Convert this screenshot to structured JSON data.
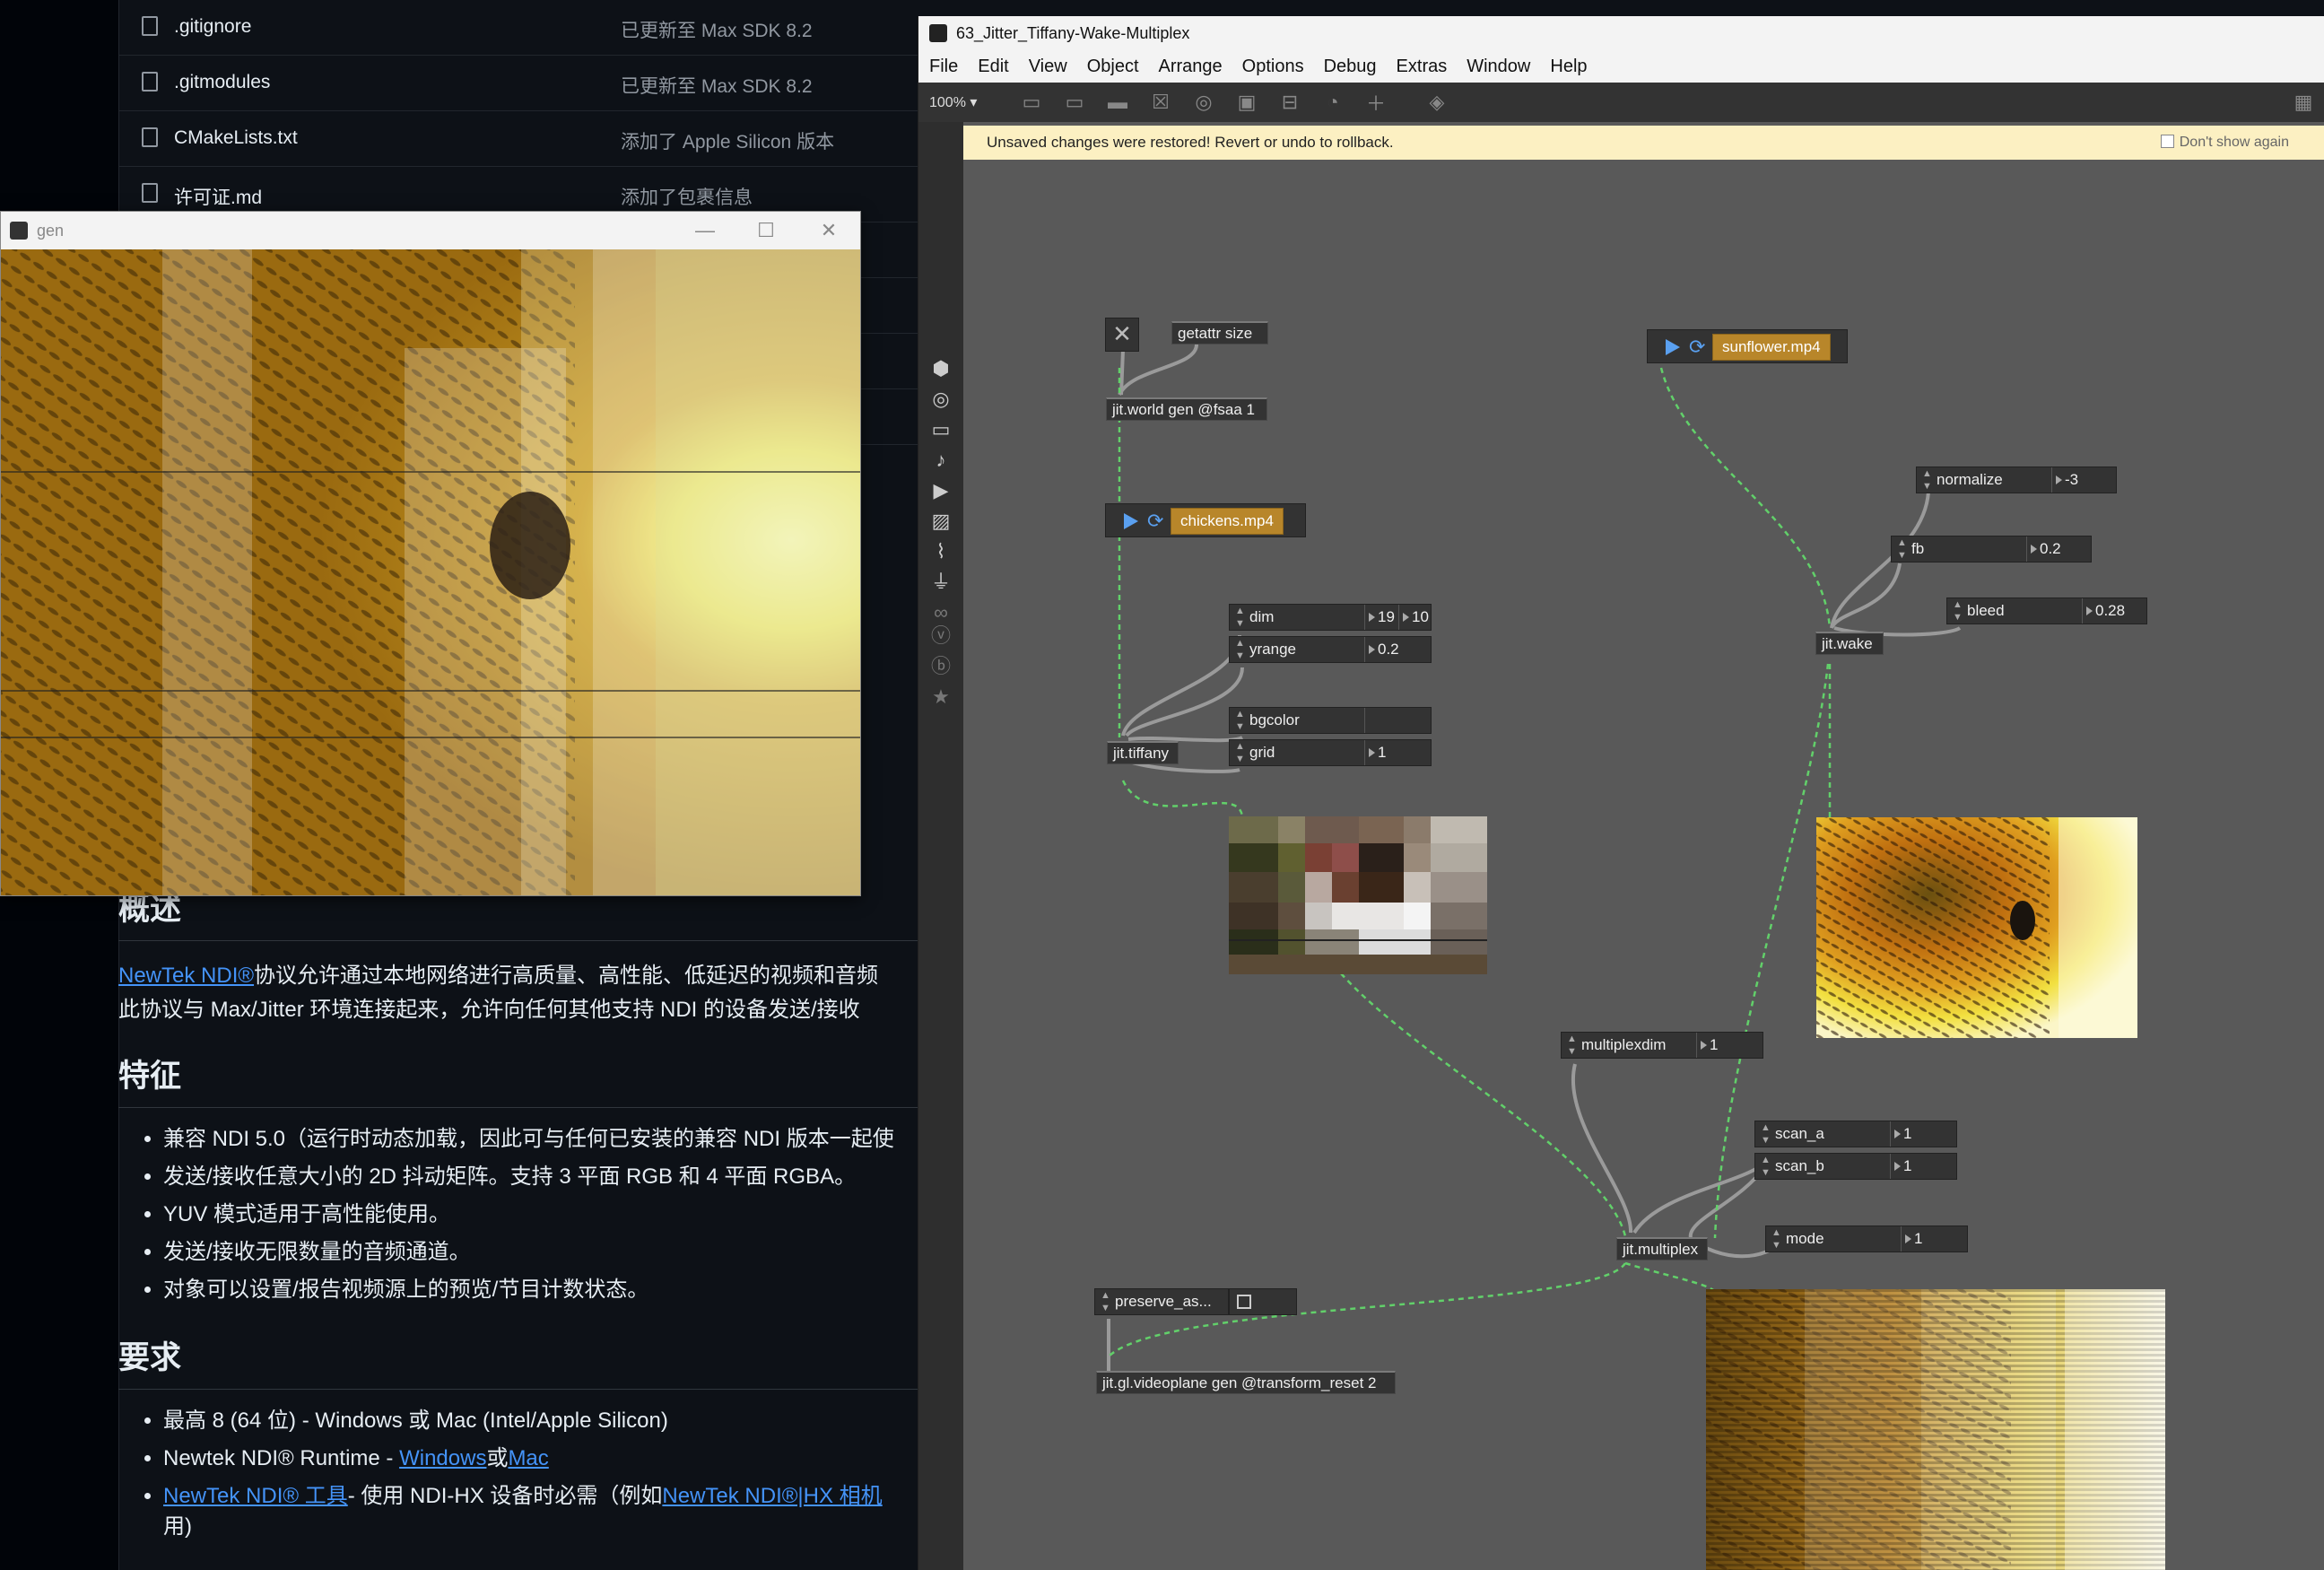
{
  "github": {
    "files": [
      {
        "name": ".gitignore",
        "message": "已更新至 Max SDK 8.2"
      },
      {
        "name": ".gitmodules",
        "message": "已更新至 Max SDK 8.2"
      },
      {
        "name": "CMakeLists.txt",
        "message": "添加了 Apple Silicon 版本"
      },
      {
        "name": "许可证.md",
        "message": "添加了包裹信息"
      }
    ],
    "overview_heading": "概述",
    "overview_link": "NewTek NDI®",
    "overview_line1": "协议允许通过本地网络进行高质量、高性能、低延迟的视频和音频",
    "overview_line2": "此协议与 Max/Jitter 环境连接起来，允许向任何其他支持 NDI 的设备发送/接收",
    "features_heading": "特征",
    "features": [
      "兼容 NDI 5.0（运行时动态加载，因此可与任何已安装的兼容 NDI 版本一起使",
      "发送/接收任意大小的 2D 抖动矩阵。支持 3 平面 RGB 和 4 平面 RGBA。",
      "YUV 模式适用于高性能使用。",
      "发送/接收无限数量的音频通道。",
      "对象可以设置/报告视频源上的预览/节目计数状态。"
    ],
    "requirements_heading": "要求",
    "req1": "最高 8 (64 位) - Windows 或 Mac (Intel/Apple Silicon)",
    "req2_prefix": "Newtek NDI® Runtime - ",
    "req2_link_windows": "Windows",
    "req2_or": "或",
    "req2_link_mac": "Mac",
    "req3_link": "NewTek NDI® 工具",
    "req3_text": "- 使用 NDI-HX 设备时必需（例如",
    "req3_link2": "NewTek NDI®|HX 相机",
    "req3_tail": "用)"
  },
  "gen_window": {
    "title": "gen",
    "minimize": "—",
    "maximize": "☐",
    "close": "✕"
  },
  "max": {
    "title": "63_Jitter_Tiffany-Wake-Multiplex",
    "menu": [
      "File",
      "Edit",
      "View",
      "Object",
      "Arrange",
      "Options",
      "Debug",
      "Extras",
      "Window",
      "Help"
    ],
    "zoom": "100% ▾",
    "notice": "Unsaved changes were restored! Revert or undo to rollback.",
    "dont_show": "Don't show again",
    "objects": {
      "getattr": "getattr size",
      "jitworld": "jit.world gen @fsaa 1",
      "sunflower_movie": "sunflower.mp4",
      "chickens_movie": "chickens.mp4",
      "jittiffany": "jit.tiffany",
      "jitwake": "jit.wake",
      "multiplexdim_label": "multiplexdim",
      "jitmultiplex": "jit.multiplex",
      "preserve": "preserve_as...",
      "videoplane": "jit.gl.videoplane gen @transform_reset 2"
    },
    "attrs": {
      "normalize": {
        "name": "normalize",
        "value": "-3"
      },
      "fb": {
        "name": "fb",
        "value": "0.2"
      },
      "bleed": {
        "name": "bleed",
        "value": "0.28"
      },
      "dim": {
        "name": "dim",
        "value": "19",
        "value2": "10"
      },
      "yrange": {
        "name": "yrange",
        "value": "0.2"
      },
      "bgcolor": {
        "name": "bgcolor",
        "value": ""
      },
      "grid": {
        "name": "grid",
        "value": "1"
      },
      "multiplexdim": {
        "name": "multiplexdim",
        "value": "1"
      },
      "scan_a": {
        "name": "scan_a",
        "value": "1"
      },
      "scan_b": {
        "name": "scan_b",
        "value": "1"
      },
      "mode": {
        "name": "mode",
        "value": "1"
      }
    },
    "toggle_x": "✕"
  },
  "icons": {
    "file": "file-icon",
    "package": "package-icon",
    "target": "target-icon",
    "music": "music-note-icon",
    "image": "image-icon",
    "clip": "paperclip-icon",
    "plug": "plug-icon",
    "star": "star-icon"
  },
  "colors": {
    "github_bg": "#0d1117",
    "link": "#4493f8",
    "notice_bg": "#fcf0c2",
    "cord_green": "#62d06a",
    "movie_bar": "#b8862a",
    "canvas_bg": "#595959"
  }
}
